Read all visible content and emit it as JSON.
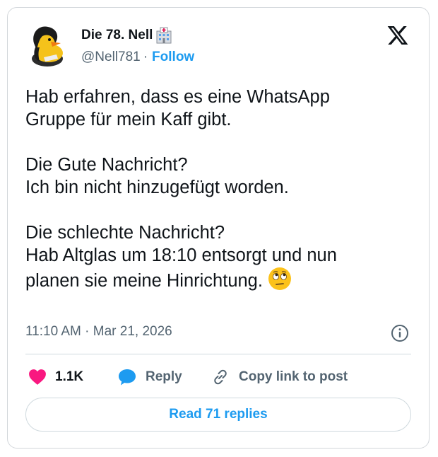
{
  "author": {
    "name": "Die 78. Nell",
    "handle": "@Nell781",
    "separator": "·",
    "follow_label": "Follow"
  },
  "tweet": {
    "paragraphs": [
      [
        "Hab erfahren, dass es eine WhatsApp",
        "Gruppe für mein Kaff gibt."
      ],
      [
        "Die Gute Nachricht?",
        "Ich bin nicht hinzugefügt worden."
      ],
      [
        "Die schlechte Nachricht?",
        "Hab Altglas um 18:10 entsorgt und nun",
        "planen sie meine Hinrichtung."
      ]
    ],
    "timestamp": "11:10 AM · Mar 21, 2026"
  },
  "actions": {
    "likes_count": "1.1K",
    "reply_label": "Reply",
    "copy_link_label": "Copy link to post"
  },
  "read_replies_label": "Read 71 replies",
  "icons": {
    "brand": "x-logo-icon",
    "name_badge": "hospital-icon",
    "avatar": "rubber-duck-avatar",
    "like": "heart-icon",
    "reply": "speech-bubble-icon",
    "copy": "link-icon",
    "info": "info-icon",
    "emoji": "eye-roll-emoji"
  },
  "colors": {
    "like": "#f91880",
    "reply": "#1d9bf0",
    "link": "#1d9bf0",
    "muted": "#536471",
    "text": "#0f1419",
    "border": "#cfd9de"
  }
}
